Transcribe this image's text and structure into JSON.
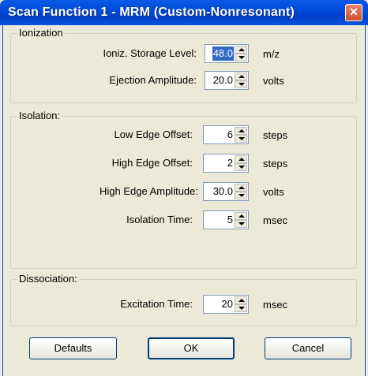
{
  "window": {
    "title": "Scan Function 1 - MRM (Custom-Nonresonant)"
  },
  "groups": {
    "ionization": {
      "title": "Ionization",
      "fields": [
        {
          "label": "Ioniz. Storage Level:",
          "value": "48.0",
          "unit": "m/z",
          "selected": true
        },
        {
          "label": "Ejection Amplitude:",
          "value": "20.0",
          "unit": "volts"
        }
      ]
    },
    "isolation": {
      "title": "Isolation:",
      "fields": [
        {
          "label": "Low Edge Offset:",
          "value": "6",
          "unit": "steps"
        },
        {
          "label": "High Edge Offset:",
          "value": "2",
          "unit": "steps"
        },
        {
          "label": "High Edge Amplitude:",
          "value": "30.0",
          "unit": "volts"
        },
        {
          "label": "Isolation Time:",
          "value": "5",
          "unit": "msec"
        }
      ]
    },
    "dissociation": {
      "title": "Dissociation:",
      "fields": [
        {
          "label": "Excitation Time:",
          "value": "20",
          "unit": "msec"
        }
      ]
    }
  },
  "buttons": {
    "defaults": "Defaults",
    "ok": "OK",
    "cancel": "Cancel"
  },
  "colors": {
    "titlebar": "#0049d6",
    "selection": "#316ac5",
    "face": "#ece9d8",
    "close": "#c9502e"
  }
}
